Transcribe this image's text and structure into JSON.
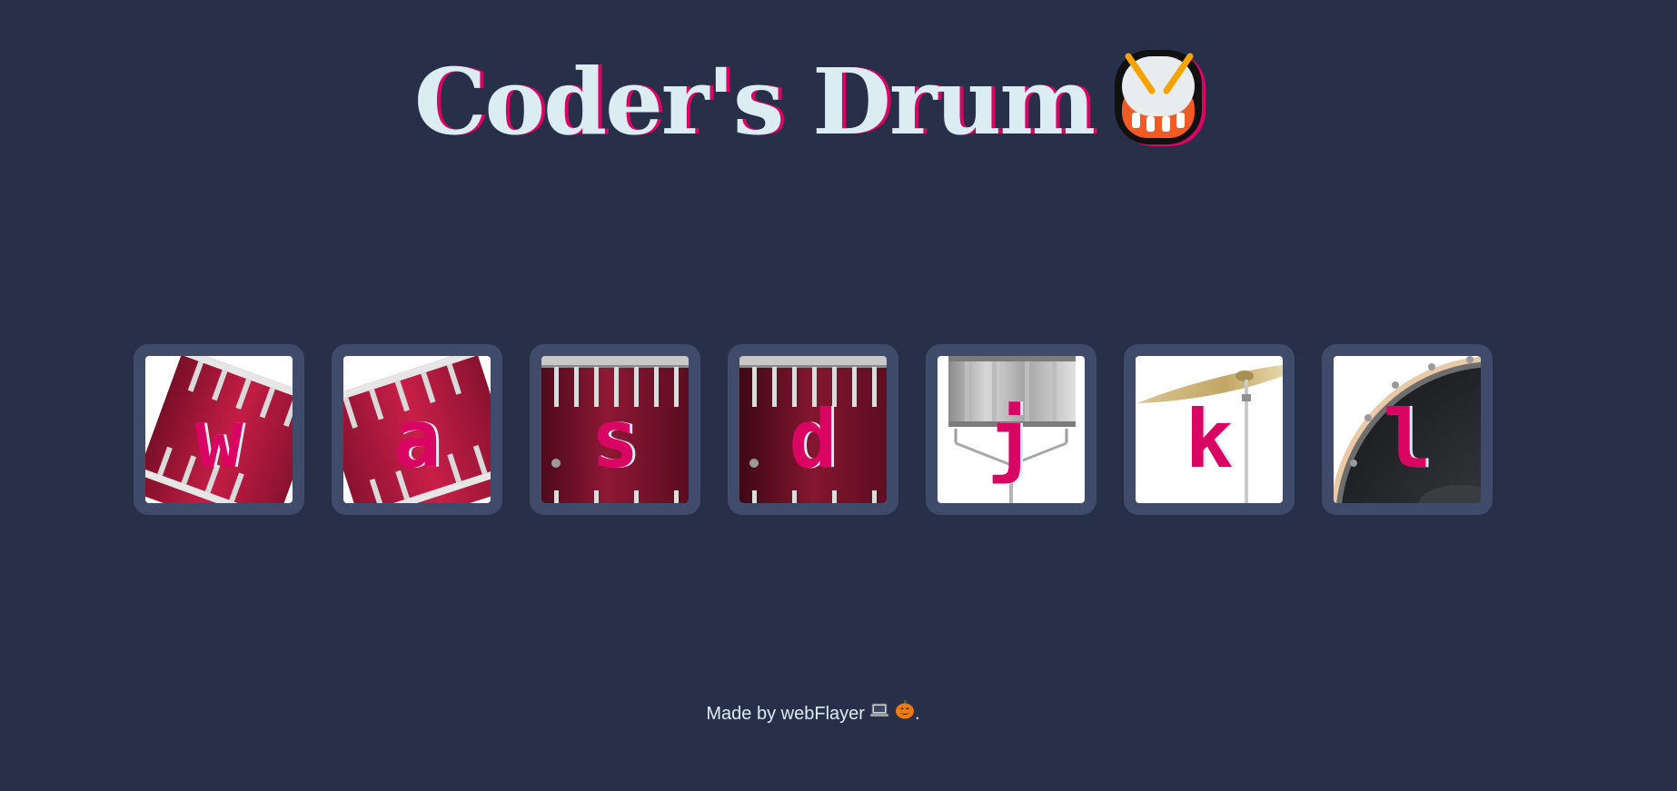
{
  "page": {
    "title": "Coder's Drum",
    "title_icon": "drum-emoji-icon"
  },
  "colors": {
    "background": "#283049",
    "key_frame": "#404b69",
    "accent": "#da0463",
    "text": "#dbedf3"
  },
  "keys": [
    {
      "letter": "w",
      "image": "tom-drum-tilted-icon"
    },
    {
      "letter": "a",
      "image": "tom-drum-tilted-icon"
    },
    {
      "letter": "s",
      "image": "bass-drum-side-icon"
    },
    {
      "letter": "d",
      "image": "bass-drum-side-icon"
    },
    {
      "letter": "j",
      "image": "snare-drum-icon"
    },
    {
      "letter": "k",
      "image": "crash-cymbal-icon"
    },
    {
      "letter": "l",
      "image": "kick-drum-head-icon"
    }
  ],
  "footer": {
    "text": "Made by webFlayer",
    "icons": [
      "laptop-icon",
      "pumpkin-icon"
    ],
    "suffix": "."
  }
}
